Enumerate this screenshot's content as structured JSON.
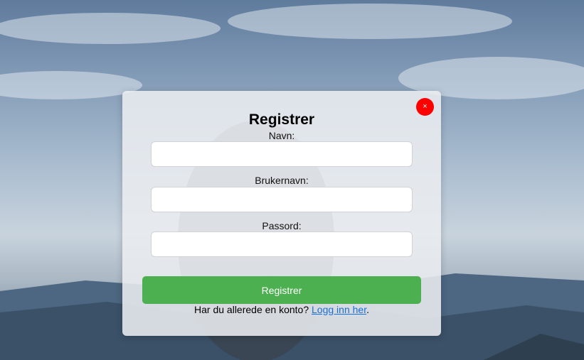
{
  "modal": {
    "close_label": "×",
    "title": "Registrer",
    "fields": [
      {
        "label": "Navn:",
        "value": ""
      },
      {
        "label": "Brukernavn:",
        "value": ""
      },
      {
        "label": "Passord:",
        "value": ""
      }
    ],
    "submit_label": "Registrer",
    "login_prompt": "Har du allerede en konto?",
    "login_link": "Logg inn her",
    "login_suffix": "."
  },
  "colors": {
    "submit": "#4cb050",
    "close": "#ff0000",
    "link": "#1a6fd6"
  }
}
